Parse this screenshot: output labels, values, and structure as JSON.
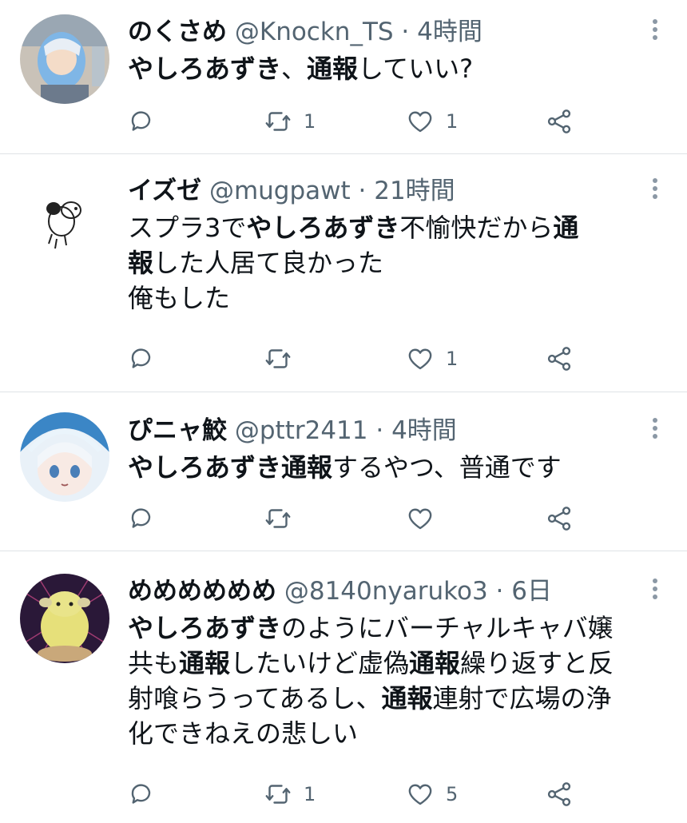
{
  "tweets": [
    {
      "name": "のくさめ",
      "handle": "@Knockn_TS",
      "time": "4時間",
      "body": [
        [
          {
            "t": "やしろあずき",
            "b": true
          },
          {
            "t": "、",
            "b": false
          },
          {
            "t": "通報",
            "b": true
          },
          {
            "t": "していい?",
            "b": false
          }
        ]
      ],
      "reply_count": "",
      "retweet_count": "1",
      "like_count": "1"
    },
    {
      "name": "イズゼ",
      "handle": "@mugpawt",
      "time": "21時間",
      "body": [
        [
          {
            "t": "スプラ3で",
            "b": false
          },
          {
            "t": "やしろあずき",
            "b": true
          },
          {
            "t": "不愉快だから",
            "b": false
          },
          {
            "t": "通",
            "b": true
          }
        ],
        [
          {
            "t": "報",
            "b": true
          },
          {
            "t": "した人居て良かった",
            "b": false
          }
        ],
        [
          {
            "t": "俺もした",
            "b": false
          }
        ]
      ],
      "reply_count": "",
      "retweet_count": "",
      "like_count": "1"
    },
    {
      "name": "ぴニャ鮫",
      "handle": "@pttr2411",
      "time": "4時間",
      "body": [
        [
          {
            "t": "やしろあずき",
            "b": true
          },
          {
            "t": "通報",
            "b": true
          },
          {
            "t": "するやつ、普通です",
            "b": false
          }
        ]
      ],
      "reply_count": "",
      "retweet_count": "",
      "like_count": ""
    },
    {
      "name": "めめめめめめ",
      "handle": "@8140nyaruko3",
      "time": "6日",
      "body": [
        [
          {
            "t": "やしろあずき",
            "b": true
          },
          {
            "t": "のようにバーチャルキャバ嬢",
            "b": false
          }
        ],
        [
          {
            "t": "共も",
            "b": false
          },
          {
            "t": "通報",
            "b": true
          },
          {
            "t": "したいけど虚偽",
            "b": false
          },
          {
            "t": "通報",
            "b": true
          },
          {
            "t": "繰り返すと反",
            "b": false
          }
        ],
        [
          {
            "t": "射喰らうってあるし、",
            "b": false
          },
          {
            "t": "通報",
            "b": true
          },
          {
            "t": "連射で広場の浄",
            "b": false
          }
        ],
        [
          {
            "t": "化できねえの悲しい",
            "b": false
          }
        ]
      ],
      "reply_count": "",
      "retweet_count": "1",
      "like_count": "5"
    }
  ],
  "header_separator": "·",
  "icons": {
    "reply": "reply-icon",
    "retweet": "retweet-icon",
    "like": "heart-icon",
    "share": "share-icon",
    "more": "more-icon"
  },
  "colors": {
    "text": "#0f1419",
    "secondary": "#536471",
    "divider": "#dfe3e6"
  }
}
